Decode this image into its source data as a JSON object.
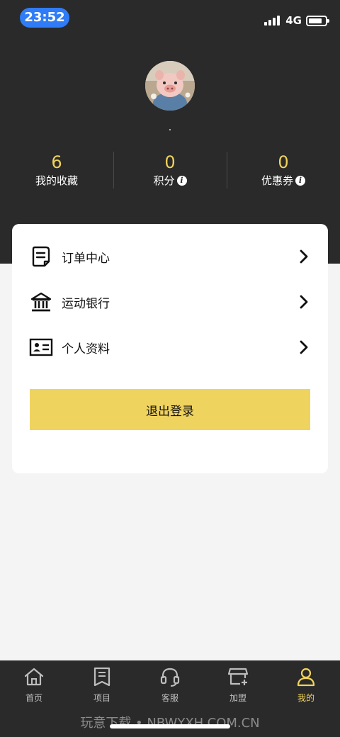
{
  "status_bar": {
    "time": "23:52",
    "network": "4G",
    "battery_level": 0.8
  },
  "profile": {
    "avatar_icon": "pig-avatar",
    "username": ".",
    "stats": [
      {
        "value": "6",
        "label": "我的收藏",
        "has_info": false
      },
      {
        "value": "0",
        "label": "积分",
        "has_info": true
      },
      {
        "value": "0",
        "label": "优惠券",
        "has_info": true
      }
    ]
  },
  "menu": {
    "items": [
      {
        "icon": "order-document-icon",
        "label": "订单中心"
      },
      {
        "icon": "bank-icon",
        "label": "运动银行"
      },
      {
        "icon": "id-card-icon",
        "label": "个人资料"
      }
    ],
    "logout_label": "退出登录"
  },
  "tabbar": {
    "tabs": [
      {
        "icon": "home-icon",
        "label": "首页",
        "active": false
      },
      {
        "icon": "project-icon",
        "label": "项目",
        "active": false
      },
      {
        "icon": "headset-icon",
        "label": "客服",
        "active": false
      },
      {
        "icon": "storefront-plus-icon",
        "label": "加盟",
        "active": false
      },
      {
        "icon": "user-icon",
        "label": "我的",
        "active": true
      }
    ],
    "watermark": "玩意下载 • NBWYXH.COM.CN"
  },
  "colors": {
    "accent": "#f0d35a",
    "header_bg": "#2a2a2a",
    "button_bg": "#efd35f",
    "time_pill": "#2f7cf6"
  }
}
